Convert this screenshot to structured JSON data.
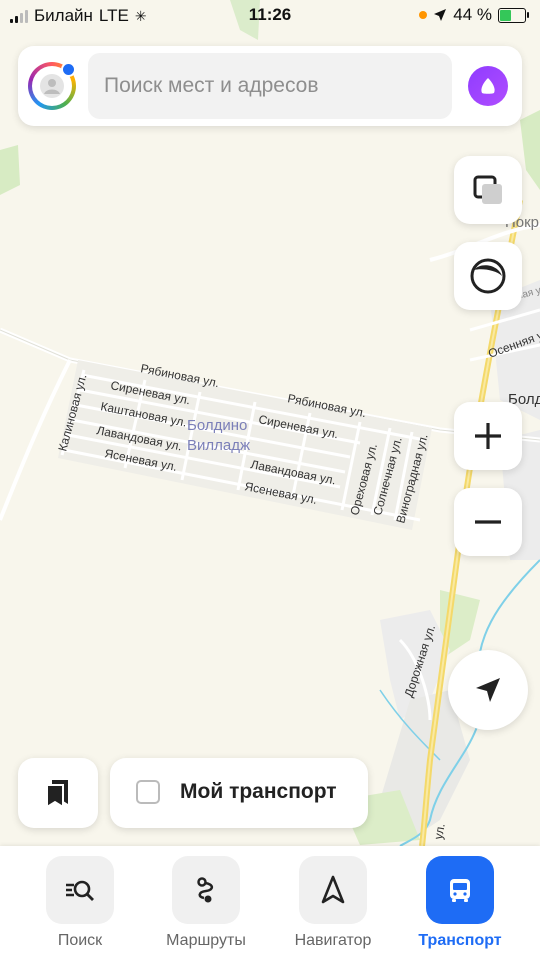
{
  "status_bar": {
    "carrier": "Билайн",
    "network": "LTE",
    "time": "11:26",
    "battery": "44 %"
  },
  "search": {
    "placeholder": "Поиск мест и адресов"
  },
  "map": {
    "district_name_line1": "Болдино",
    "district_name_line2": "Вилладж",
    "streets": {
      "ryabinovaya_a": "Рябиновая ул.",
      "ryabinovaya_b": "Рябиновая ул.",
      "sirenevaya_a": "Сиреневая ул.",
      "sirenevaya_b": "Сиреневая ул.",
      "kashtanovaya": "Каштановая ул.",
      "lavandovaya_a": "Лавандовая ул.",
      "lavandovaya_b": "Лавандовая ул.",
      "yasenevaya_a": "Ясеневая ул.",
      "yasenevaya_b": "Ясеневая ул.",
      "kalinovaya": "Калиновая ул.",
      "orekhovaya": "Ореховая ул.",
      "solnechnaya": "Солнечная ул.",
      "vinogradnaya": "Виноградная ул.",
      "dorozhnaya": "Дорожная ул.",
      "osennyaya": "Осенняя ул.",
      "zelenaya": "Зелёная ул.",
      "bottom_ul": "ул."
    },
    "edge_labels": {
      "pokr": "Покр",
      "bold": "Болд"
    }
  },
  "my_transport": {
    "label": "Мой транспорт"
  },
  "tabs": [
    {
      "label": "Поиск",
      "icon": "search-list-icon"
    },
    {
      "label": "Маршруты",
      "icon": "route-icon"
    },
    {
      "label": "Навигатор",
      "icon": "navigator-arrow-icon"
    },
    {
      "label": "Транспорт",
      "icon": "bus-icon"
    }
  ],
  "colors": {
    "accent": "#1e6cf5",
    "alice": "#8f3cff",
    "map_bg": "#f8f6ec",
    "road_yellow": "#f4d96a",
    "river": "#7fd0e8",
    "greenery": "#d9ecc4"
  }
}
